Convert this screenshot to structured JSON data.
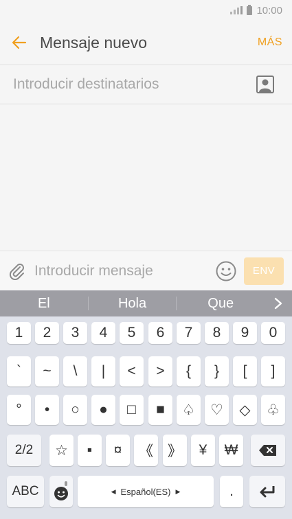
{
  "status": {
    "time": "10:00"
  },
  "app_bar": {
    "title": "Mensaje nuevo",
    "more_label": "MÁS"
  },
  "recipient": {
    "placeholder": "Introducir destinatarios"
  },
  "compose": {
    "placeholder": "Introducir mensaje",
    "send_label": "ENV"
  },
  "suggestions": [
    "El",
    "Hola",
    "Que"
  ],
  "keyboard": {
    "row1": [
      "1",
      "2",
      "3",
      "4",
      "5",
      "6",
      "7",
      "8",
      "9",
      "0"
    ],
    "row2": [
      "`",
      "~",
      "\\",
      "|",
      "<",
      ">",
      "{",
      "}",
      "[",
      "]"
    ],
    "row3": [
      "°",
      "•",
      "○",
      "●",
      "□",
      "■",
      "♤",
      "♡",
      "◇",
      "♧"
    ],
    "row4": [
      "☆",
      "▪",
      "¤",
      "《",
      "》",
      "¥",
      "₩"
    ],
    "page_label": "2/2",
    "abc_label": "ABC",
    "language_label": "Español(ES)",
    "period_label": "."
  },
  "colors": {
    "accent": "#f0a020",
    "send_disabled": "#fbe0b0",
    "suggestion_bar": "#9e9ea4",
    "keyboard_bg": "#dfe2ea"
  }
}
